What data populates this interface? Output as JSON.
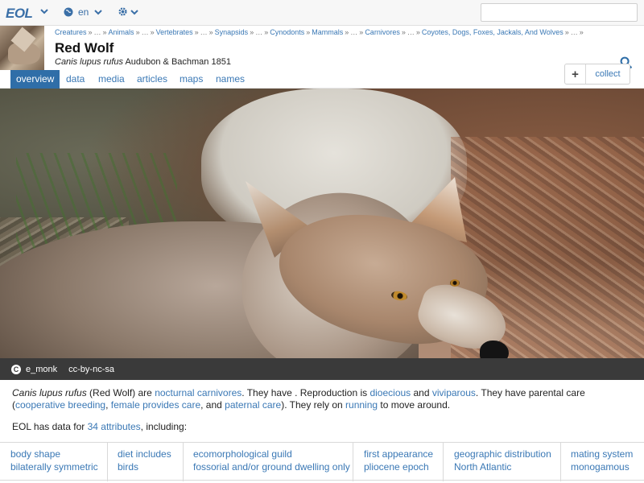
{
  "topbar": {
    "logo": "EOL",
    "language": "en",
    "search": {
      "value": "",
      "placeholder": ""
    }
  },
  "breadcrumbs": [
    "Creatures",
    "…",
    "Animals",
    "…",
    "Vertebrates",
    "…",
    "Synapsids",
    "…",
    "Cynodonts",
    "Mammals",
    "…",
    "Carnivores",
    "…",
    "Coyotes, Dogs, Foxes, Jackals, And Wolves",
    "…"
  ],
  "page": {
    "title": "Red Wolf",
    "scientific_name": "Canis lupus rufus",
    "authority": "Audubon & Bachman 1851",
    "collect_label": "collect"
  },
  "tabs": [
    "overview",
    "data",
    "media",
    "articles",
    "maps",
    "names"
  ],
  "active_tab": "overview",
  "image_caption": {
    "author": "e_monk",
    "license": "cc-by-nc-sa"
  },
  "summary": {
    "sci_name": "Canis lupus rufus",
    "p1": " (Red Wolf) are ",
    "l1": "nocturnal",
    "p2": " ",
    "l2": "carnivores",
    "p3": ". They have . Reproduction is ",
    "l3": "dioecious",
    "p4": " and ",
    "l4": "viviparous",
    "p5": ". They have parental care (",
    "l5": "cooperative breeding",
    "p6": ", ",
    "l6": "female provides care",
    "p7": ", and ",
    "l7": "paternal care",
    "p8": "). They rely on ",
    "l8": "running",
    "p9": " to move around."
  },
  "data_note": {
    "prefix": "EOL has data for ",
    "link": "34 attributes",
    "suffix": ", including:"
  },
  "attributes": [
    {
      "key": "body shape",
      "value": "bilaterally symmetric"
    },
    {
      "key": "diet includes",
      "value": "birds"
    },
    {
      "key": "ecomorphological guild",
      "value": "fossorial and/or ground dwelling only"
    },
    {
      "key": "first appearance",
      "value": "pliocene epoch"
    },
    {
      "key": "geographic distribution",
      "value": "North Atlantic"
    },
    {
      "key": "mating system",
      "value": "monogamous"
    }
  ],
  "colors": {
    "link": "#3a78b5",
    "active_tab": "#2f6ea8",
    "caption_bar": "#3a3a3a"
  }
}
